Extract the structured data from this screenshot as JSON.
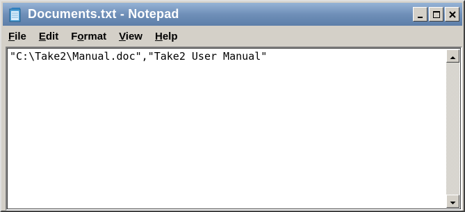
{
  "window": {
    "title": "Documents.txt - Notepad"
  },
  "menu": {
    "items": [
      {
        "accel": "F",
        "rest": "ile"
      },
      {
        "accel": "E",
        "rest": "dit"
      },
      {
        "pre": "F",
        "accel": "o",
        "rest": "rmat"
      },
      {
        "accel": "V",
        "rest": "iew"
      },
      {
        "accel": "H",
        "rest": "elp"
      }
    ]
  },
  "editor": {
    "content": "\"C:\\Take2\\Manual.doc\",\"Take2 User Manual\""
  },
  "icons": {
    "app": "notepad-icon",
    "minimize": "minimize-icon",
    "maximize": "maximize-icon",
    "close": "close-icon",
    "scroll_up": "arrow-up-icon",
    "scroll_down": "arrow-down-icon"
  },
  "colors": {
    "titlebar": "#6f8fb8",
    "window_face": "#d4d0c8",
    "editor_bg": "#ffffff"
  }
}
